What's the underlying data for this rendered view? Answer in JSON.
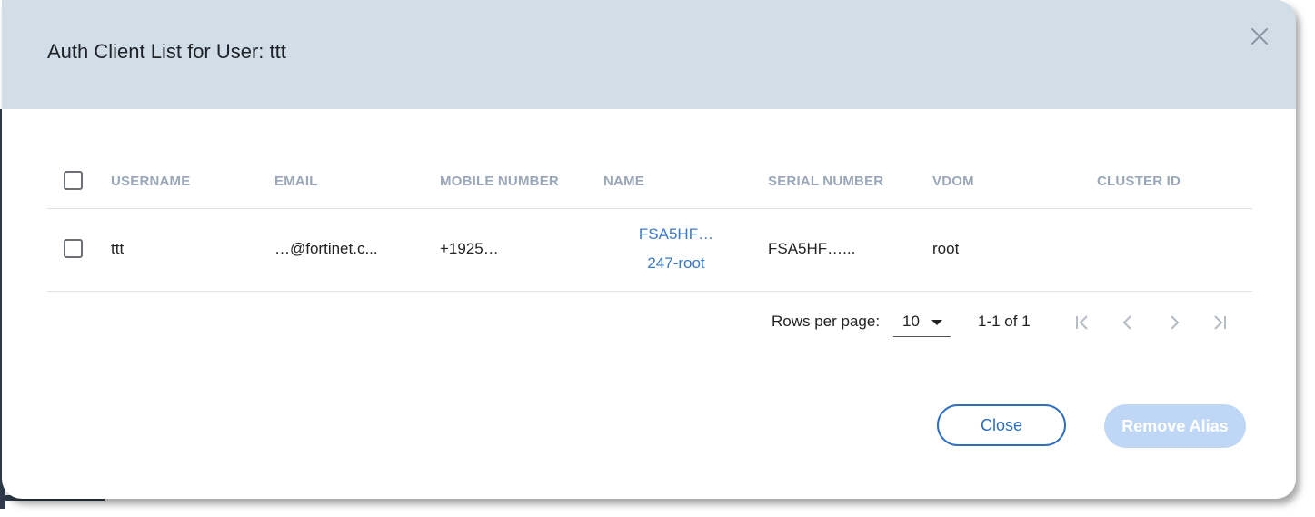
{
  "dialog": {
    "title": "Auth Client List for User: ttt",
    "close_icon": "close-icon"
  },
  "table": {
    "columns": [
      "USERNAME",
      "EMAIL",
      "MOBILE NUMBER",
      "NAME",
      "SERIAL NUMBER",
      "VDOM",
      "CLUSTER ID"
    ],
    "rows": [
      {
        "username": "ttt",
        "email": "…@fortinet.c...",
        "mobile": "+1925…",
        "name_line1": "FSA5HF…",
        "name_line2": "247-root",
        "serial": "FSA5HF…...",
        "vdom": "root",
        "cluster_id": ""
      }
    ]
  },
  "pagination": {
    "rows_per_page_label": "Rows per page:",
    "rows_per_page_value": "10",
    "range": "1-1 of 1"
  },
  "footer": {
    "close_label": "Close",
    "remove_alias_label": "Remove Alias"
  },
  "colors": {
    "header_bg": "#d1dde7",
    "link": "#3a78c9",
    "primary": "#2f6fbf",
    "disabled_primary": "#bfd7f5"
  }
}
